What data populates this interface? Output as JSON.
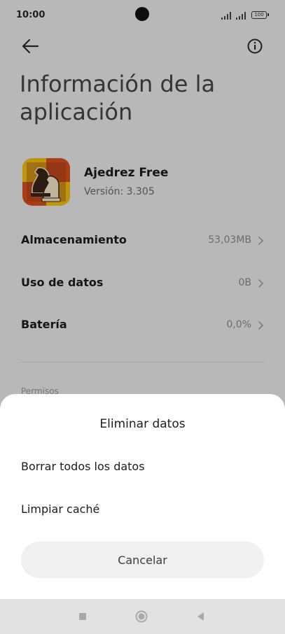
{
  "status_bar": {
    "time": "10:00",
    "battery": "100"
  },
  "header": {
    "back_icon": "arrow-left-icon",
    "info_icon": "info-icon",
    "title": "Información de la aplicación"
  },
  "app": {
    "name": "Ajedrez Free",
    "version": "Versión: 3.305",
    "icon": "chess-knight-icon"
  },
  "rows": [
    {
      "label": "Almacenamiento",
      "value": "53,03MB"
    },
    {
      "label": "Uso de datos",
      "value": "0B"
    },
    {
      "label": "Batería",
      "value": "0,0%"
    }
  ],
  "section": {
    "permissions_label": "Permisos"
  },
  "sheet": {
    "title": "Eliminar datos",
    "options": [
      {
        "label": "Borrar todos los datos"
      },
      {
        "label": "Limpiar caché"
      }
    ],
    "cancel_label": "Cancelar"
  },
  "nav_bar": {
    "icons": [
      "recents-square-icon",
      "home-circle-icon",
      "back-triangle-icon"
    ]
  },
  "colors": {
    "background": "#ececec",
    "sheet": "#ffffff",
    "cancel_button": "#f0f0f0",
    "app_icon_primary": "#d94f1c",
    "app_icon_secondary": "#f3c012"
  }
}
